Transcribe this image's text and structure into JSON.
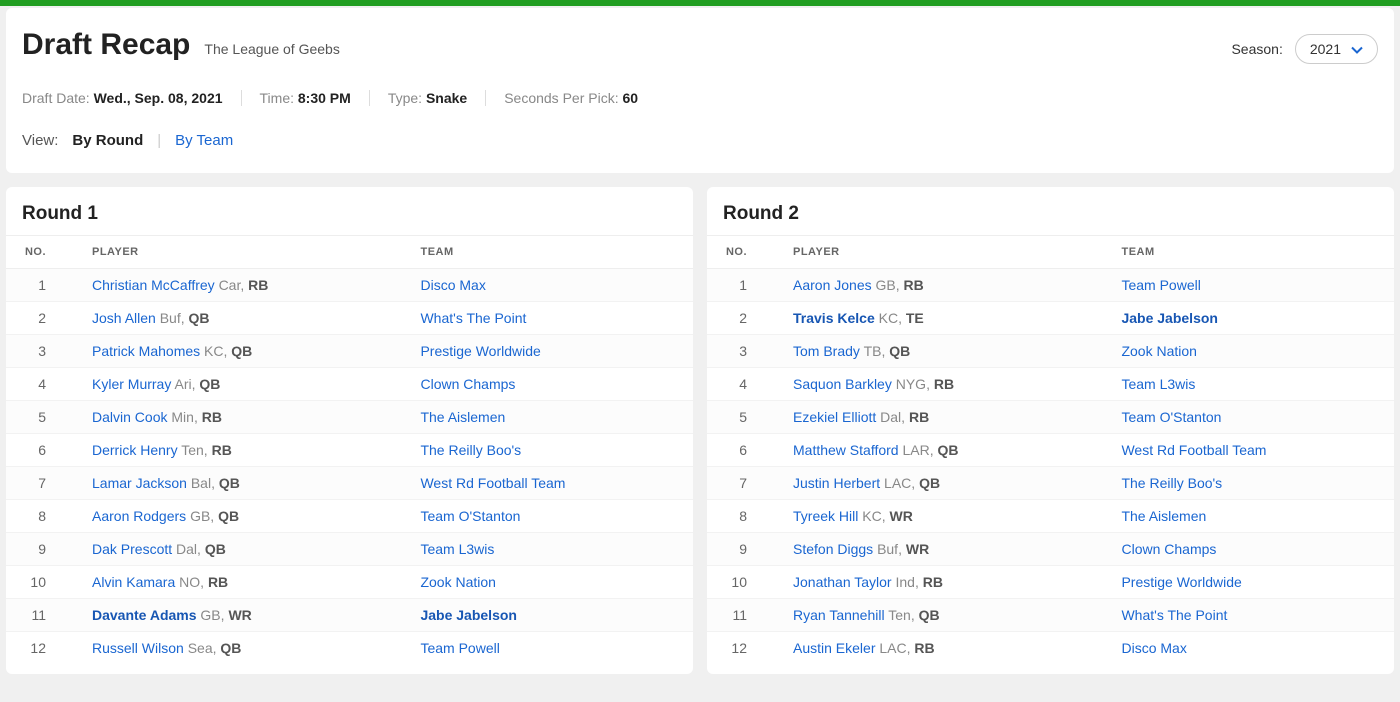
{
  "header": {
    "title": "Draft Recap",
    "league": "The League of Geebs",
    "season_label": "Season:",
    "season_value": "2021",
    "meta": {
      "date_label": "Draft Date: ",
      "date_value": "Wed., Sep. 08, 2021",
      "time_label": "Time: ",
      "time_value": "8:30 PM",
      "type_label": "Type: ",
      "type_value": "Snake",
      "secs_label": "Seconds Per Pick: ",
      "secs_value": "60"
    },
    "view": {
      "label": "View:",
      "by_round": "By Round",
      "by_team": "By Team"
    }
  },
  "columns": {
    "no": "NO.",
    "player": "PLAYER",
    "team": "TEAM"
  },
  "rounds": [
    {
      "title": "Round 1",
      "picks": [
        {
          "no": "1",
          "player": "Christian McCaffrey",
          "det": "Car",
          "pos": "RB",
          "team": "Disco Max"
        },
        {
          "no": "2",
          "player": "Josh Allen",
          "det": "Buf",
          "pos": "QB",
          "team": "What's The Point"
        },
        {
          "no": "3",
          "player": "Patrick Mahomes",
          "det": "KC",
          "pos": "QB",
          "team": "Prestige Worldwide"
        },
        {
          "no": "4",
          "player": "Kyler Murray",
          "det": "Ari",
          "pos": "QB",
          "team": "Clown Champs"
        },
        {
          "no": "5",
          "player": "Dalvin Cook",
          "det": "Min",
          "pos": "RB",
          "team": "The Aislemen"
        },
        {
          "no": "6",
          "player": "Derrick Henry",
          "det": "Ten",
          "pos": "RB",
          "team": "The Reilly Boo's"
        },
        {
          "no": "7",
          "player": "Lamar Jackson",
          "det": "Bal",
          "pos": "QB",
          "team": "West Rd Football Team"
        },
        {
          "no": "8",
          "player": "Aaron Rodgers",
          "det": "GB",
          "pos": "QB",
          "team": "Team O'Stanton"
        },
        {
          "no": "9",
          "player": "Dak Prescott",
          "det": "Dal",
          "pos": "QB",
          "team": "Team L3wis"
        },
        {
          "no": "10",
          "player": "Alvin Kamara",
          "det": "NO",
          "pos": "RB",
          "team": "Zook Nation"
        },
        {
          "no": "11",
          "player": "Davante Adams",
          "det": "GB",
          "pos": "WR",
          "team": "Jabe Jabelson",
          "highlight": true
        },
        {
          "no": "12",
          "player": "Russell Wilson",
          "det": "Sea",
          "pos": "QB",
          "team": "Team Powell"
        }
      ]
    },
    {
      "title": "Round 2",
      "picks": [
        {
          "no": "1",
          "player": "Aaron Jones",
          "det": "GB",
          "pos": "RB",
          "team": "Team Powell"
        },
        {
          "no": "2",
          "player": "Travis Kelce",
          "det": "KC",
          "pos": "TE",
          "team": "Jabe Jabelson",
          "highlight": true
        },
        {
          "no": "3",
          "player": "Tom Brady",
          "det": "TB",
          "pos": "QB",
          "team": "Zook Nation"
        },
        {
          "no": "4",
          "player": "Saquon Barkley",
          "det": "NYG",
          "pos": "RB",
          "team": "Team L3wis"
        },
        {
          "no": "5",
          "player": "Ezekiel Elliott",
          "det": "Dal",
          "pos": "RB",
          "team": "Team O'Stanton"
        },
        {
          "no": "6",
          "player": "Matthew Stafford",
          "det": "LAR",
          "pos": "QB",
          "team": "West Rd Football Team"
        },
        {
          "no": "7",
          "player": "Justin Herbert",
          "det": "LAC",
          "pos": "QB",
          "team": "The Reilly Boo's"
        },
        {
          "no": "8",
          "player": "Tyreek Hill",
          "det": "KC",
          "pos": "WR",
          "team": "The Aislemen"
        },
        {
          "no": "9",
          "player": "Stefon Diggs",
          "det": "Buf",
          "pos": "WR",
          "team": "Clown Champs"
        },
        {
          "no": "10",
          "player": "Jonathan Taylor",
          "det": "Ind",
          "pos": "RB",
          "team": "Prestige Worldwide"
        },
        {
          "no": "11",
          "player": "Ryan Tannehill",
          "det": "Ten",
          "pos": "QB",
          "team": "What's The Point"
        },
        {
          "no": "12",
          "player": "Austin Ekeler",
          "det": "LAC",
          "pos": "RB",
          "team": "Disco Max"
        }
      ]
    }
  ]
}
